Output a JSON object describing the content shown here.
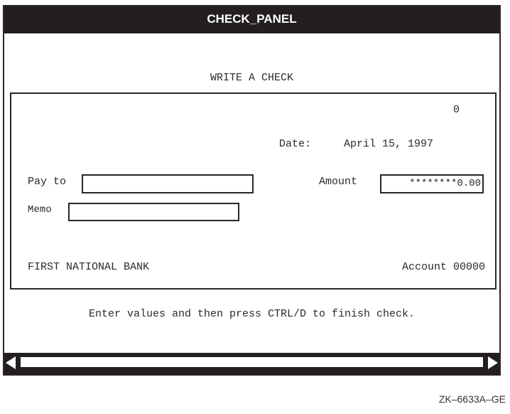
{
  "window": {
    "title": "CHECK_PANEL"
  },
  "panel": {
    "heading": "WRITE A CHECK",
    "check_number": "0",
    "date_label": "Date:",
    "date_value": "April 15, 1997",
    "pay_to": {
      "label": "Pay to",
      "value": ""
    },
    "memo": {
      "label": "Memo",
      "value": ""
    },
    "amount": {
      "label": "Amount",
      "value": "********0.00"
    },
    "bank_name": "FIRST NATIONAL BANK",
    "account": "Account 00000"
  },
  "hint": "Enter values and then press CTRL/D to finish check.",
  "scrollbar": {
    "left_icon": "arrow-left-icon",
    "right_icon": "arrow-right-icon"
  },
  "figure_id": "ZK–6633A–GE",
  "colors": {
    "title_bar": "#231f20",
    "title_text": "#ffffff",
    "border": "#2b2726"
  }
}
